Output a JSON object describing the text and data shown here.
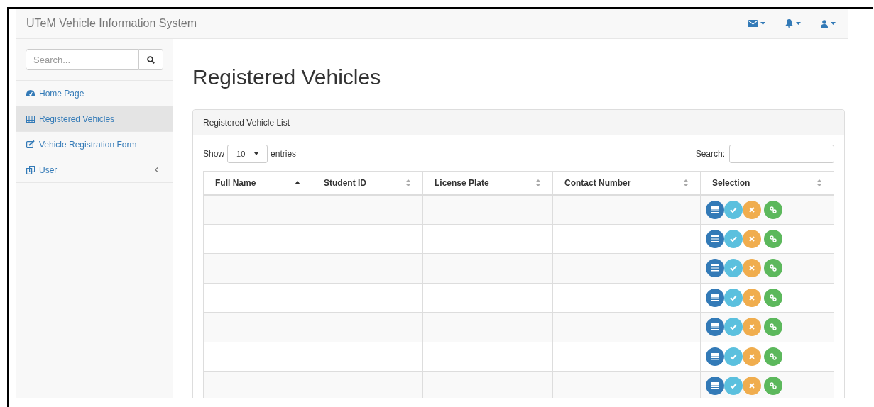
{
  "navbar": {
    "brand": "UTeM Vehicle Information System"
  },
  "sidebar": {
    "search": {
      "placeholder": "Search..."
    },
    "items": [
      {
        "label": "Home Page",
        "selected": false,
        "has_submenu": false
      },
      {
        "label": "Registered Vehicles",
        "selected": true,
        "has_submenu": false
      },
      {
        "label": "Vehicle Registration Form",
        "selected": false,
        "has_submenu": false
      },
      {
        "label": "User",
        "selected": false,
        "has_submenu": true
      }
    ]
  },
  "page_title": "Registered Vehicles",
  "panel": {
    "title": "Registered Vehicle List",
    "length": {
      "before": "Show",
      "value": "10",
      "after": "entries"
    },
    "search_label": "Search:",
    "table": {
      "columns": [
        {
          "label": "Full Name",
          "kind": "sorted_ascending"
        },
        {
          "label": "Student ID",
          "kind": "sortable"
        },
        {
          "label": "License Plate",
          "kind": "sortable"
        },
        {
          "label": "Contact Number",
          "kind": "sortable"
        },
        {
          "label": "Selection",
          "kind": "sortable"
        }
      ],
      "rows": [
        {
          "actions": [
            {
              "kind": "details"
            },
            {
              "kind": "approve"
            },
            {
              "kind": "reject"
            },
            {
              "kind": "link"
            }
          ]
        },
        {
          "actions": [
            {
              "kind": "details"
            },
            {
              "kind": "approve"
            },
            {
              "kind": "reject"
            },
            {
              "kind": "link"
            }
          ]
        },
        {
          "actions": [
            {
              "kind": "details"
            },
            {
              "kind": "approve"
            },
            {
              "kind": "reject"
            },
            {
              "kind": "link"
            }
          ]
        },
        {
          "actions": [
            {
              "kind": "details"
            },
            {
              "kind": "approve"
            },
            {
              "kind": "reject"
            },
            {
              "kind": "link"
            }
          ]
        },
        {
          "actions": [
            {
              "kind": "details"
            },
            {
              "kind": "approve"
            },
            {
              "kind": "reject"
            },
            {
              "kind": "link"
            }
          ]
        },
        {
          "actions": [
            {
              "kind": "details"
            },
            {
              "kind": "approve"
            },
            {
              "kind": "reject"
            },
            {
              "kind": "link"
            }
          ]
        },
        {
          "actions": [
            {
              "kind": "details"
            },
            {
              "kind": "approve"
            },
            {
              "kind": "reject"
            },
            {
              "kind": "link"
            }
          ]
        }
      ]
    }
  }
}
